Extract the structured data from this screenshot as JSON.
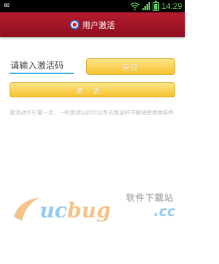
{
  "status_bar": {
    "time": "14:29",
    "icons": [
      "app-notification-icon",
      "wifi-icon",
      "signal-icon",
      "battery-icon"
    ]
  },
  "header": {
    "title": "用户激活",
    "logo_icon": "app-logo-icon",
    "color": "#a3172a"
  },
  "form": {
    "code_placeholder": "请输入激活码",
    "get_button": "获取",
    "activate_button": "激活",
    "note": "激活动作只需一次，一经激活以后可以免去登录环节直接使用本软件",
    "accent_color": "#f6c22f",
    "input_underline_color": "#3aa9e8"
  },
  "watermark": {
    "site_name": "软件下载站",
    "logo_main": "uc",
    "logo_accent": "bug",
    "logo_suffix": ".cc"
  }
}
